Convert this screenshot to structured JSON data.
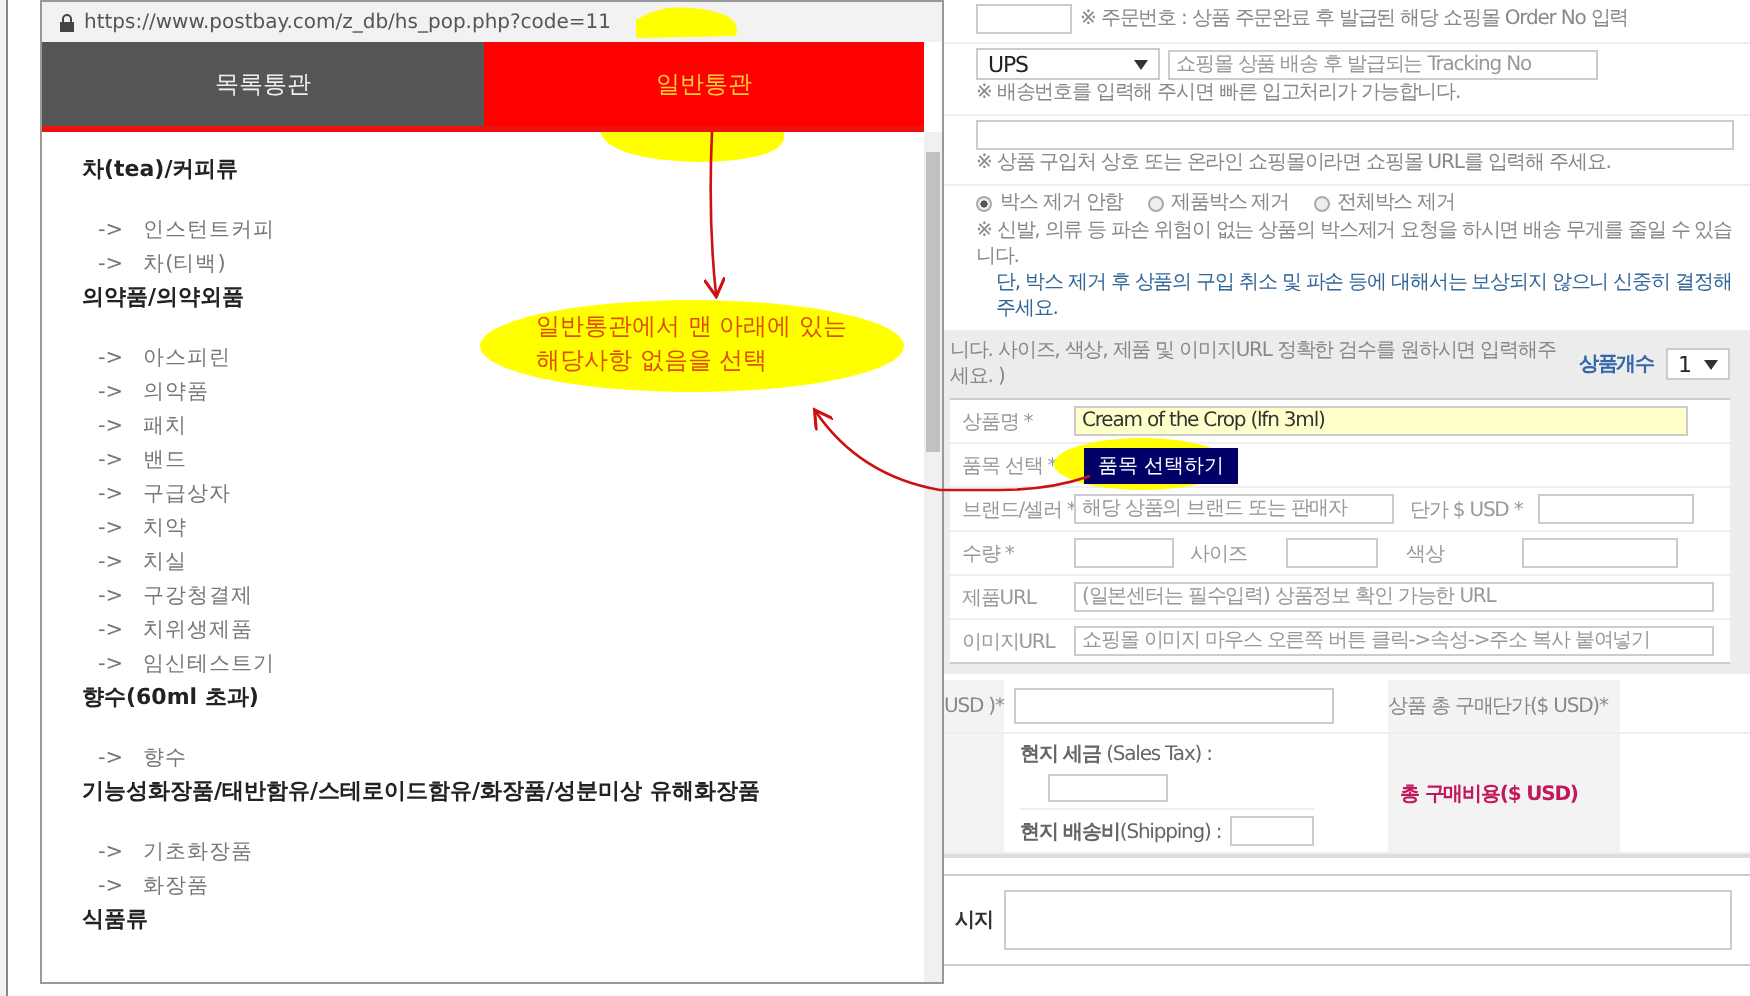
{
  "popup": {
    "url": "https://www.postbay.com/z_db/hs_pop.php?code=11",
    "tabs": [
      {
        "label": "목록통관",
        "selected": false
      },
      {
        "label": "일반통관",
        "selected": true
      }
    ],
    "categories": [
      {
        "title": "차(tea)/커피류",
        "items": [
          {
            "arrow": "->",
            "label": "인스턴트커피"
          },
          {
            "arrow": "->",
            "label": "차(티백)"
          }
        ]
      },
      {
        "title": "의약품/의약외품",
        "items": [
          {
            "arrow": "->",
            "label": "아스피린"
          },
          {
            "arrow": "->",
            "label": "의약품"
          },
          {
            "arrow": "->",
            "label": "패치"
          },
          {
            "arrow": "->",
            "label": "밴드"
          },
          {
            "arrow": "->",
            "label": "구급상자"
          },
          {
            "arrow": "->",
            "label": "치약"
          },
          {
            "arrow": "->",
            "label": "치실"
          },
          {
            "arrow": "->",
            "label": "구강청결제"
          },
          {
            "arrow": "->",
            "label": "치위생제품"
          },
          {
            "arrow": "->",
            "label": "임신테스트기"
          }
        ]
      },
      {
        "title": "향수(60ml 초과)",
        "items": [
          {
            "arrow": "->",
            "label": "향수"
          }
        ]
      },
      {
        "title": "기능성화장품/태반함유/스테로이드함유/화장품/성분미상 유해화장품",
        "items": [
          {
            "arrow": "->",
            "label": "기초화장품"
          },
          {
            "arrow": "->",
            "label": "화장품"
          }
        ]
      },
      {
        "title": "식품류"
      }
    ]
  },
  "annotation": {
    "lines": [
      "일반통관에서 맨 아래에 있는",
      "해당사항 없음을 선택"
    ]
  },
  "order_note": "※ 주문번호 : 상품 주문완료 후 발급된 해당 쇼핑몰 Order No 입력",
  "tracking": {
    "carrier": "UPS",
    "placeholder": "쇼핑몰 상품 배송 후 발급되는 Tracking No",
    "note": "※ 배송번호를 입력해 주시면 빠른 입고처리가 가능합니다."
  },
  "shop": {
    "note": "※ 상품 구입처 상호 또는 온라인 쇼핑몰이라면 쇼핑몰 URL를 입력해 주세요."
  },
  "box_removal": {
    "options": [
      {
        "label": "박스 제거 안함",
        "selected": true
      },
      {
        "label": "제품박스 제거",
        "selected": false
      },
      {
        "label": "전체박스 제거",
        "selected": false
      }
    ],
    "note": "※ 신발, 의류 등 파손 위험이 없는 상품의 박스제거 요청을 하시면 배송 무게를 줄일 수 있습니다.",
    "warning": "단, 박스 제거 후 상품의 구입 취소 및 파손 등에 대해서는 보상되지 않으니 신중히 결정해 주세요."
  },
  "product": {
    "intro": "니다. 사이즈, 색상, 제품 및 이미지URL 정확한 검수를 원하시면 입력해주세요. )",
    "count_label": "상품개수",
    "count": "1",
    "name_label": "상품명 *",
    "name_value": "Cream of the Crop (lfn 3ml)",
    "category_label": "품목 선택 *",
    "category_button": "품목 선택하기",
    "brand_label": "브랜드/셀러 *",
    "brand_placeholder": "해당 상품의 브랜드 또는 판매자",
    "price_label": "단가 $ USD *",
    "qty_label": "수량 *",
    "size_label": "사이즈",
    "color_label": "색상",
    "url_label": "제품URL",
    "url_placeholder": "(일본센터는 필수입력) 상품정보 확인 가능한 URL",
    "image_label": "이미지URL",
    "image_placeholder": "쇼핑몰 이미지 마우스 오른쪽 버튼 클릭->속성->주소 복사 붙여넣기"
  },
  "totals": {
    "unit_label": "USD )*",
    "total_unit_label": "상품 총 구매단가($ USD)*",
    "tax_label": "**현지 세금** (Sales Tax) :",
    "shipping_label": "**현지 배송비**(Shipping) :",
    "total_cost_label": "총 구매비용($ USD)"
  },
  "message": {
    "label": "시지"
  }
}
